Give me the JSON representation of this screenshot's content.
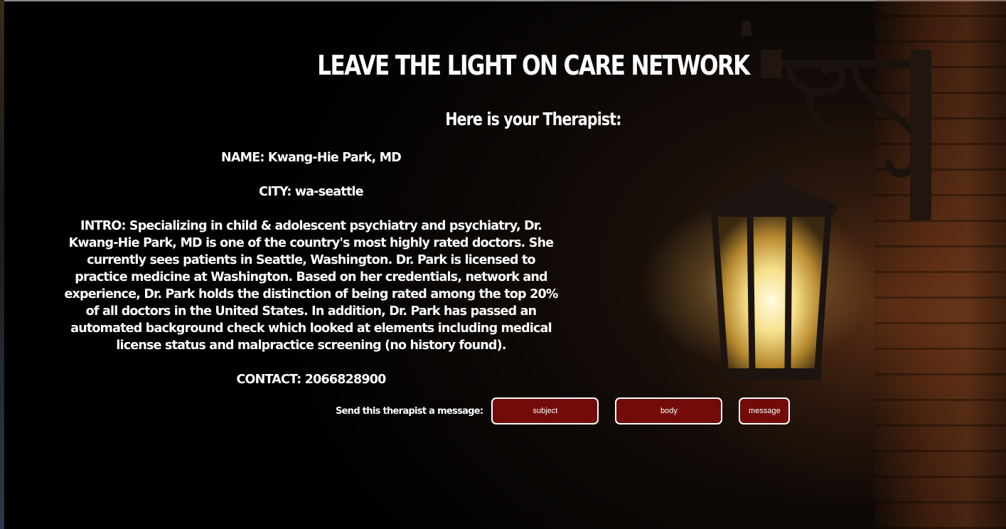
{
  "header": {
    "title": "LEAVE THE LIGHT ON CARE NETWORK",
    "subtitle": "Here is your Therapist:"
  },
  "therapist": {
    "name": "NAME: Kwang-Hie Park, MD",
    "city": "CITY: wa-seattle",
    "intro": "INTRO: Specializing in child & adolescent psychiatry and psychiatry, Dr. Kwang-Hie Park, MD is one of the country's most highly rated doctors. She currently sees patients in Seattle, Washington. Dr. Park is licensed to practice medicine at Washington. Based on her credentials, network and experience, Dr. Park holds the distinction of being rated among the top 20% of all doctors in the United States. In addition, Dr. Park has passed an automated background check which looked at elements including medical license status and malpractice screening (no history found).",
    "contact": "CONTACT: 2066828900"
  },
  "message_form": {
    "label": "Send this therapist a message:",
    "subject_button": "subject",
    "body_button": "body",
    "message_button": "message"
  },
  "colors": {
    "button_bg": "#740b0b",
    "button_border": "#ffffff",
    "text": "#ffffff"
  },
  "icons": {
    "background": "lantern-image"
  }
}
